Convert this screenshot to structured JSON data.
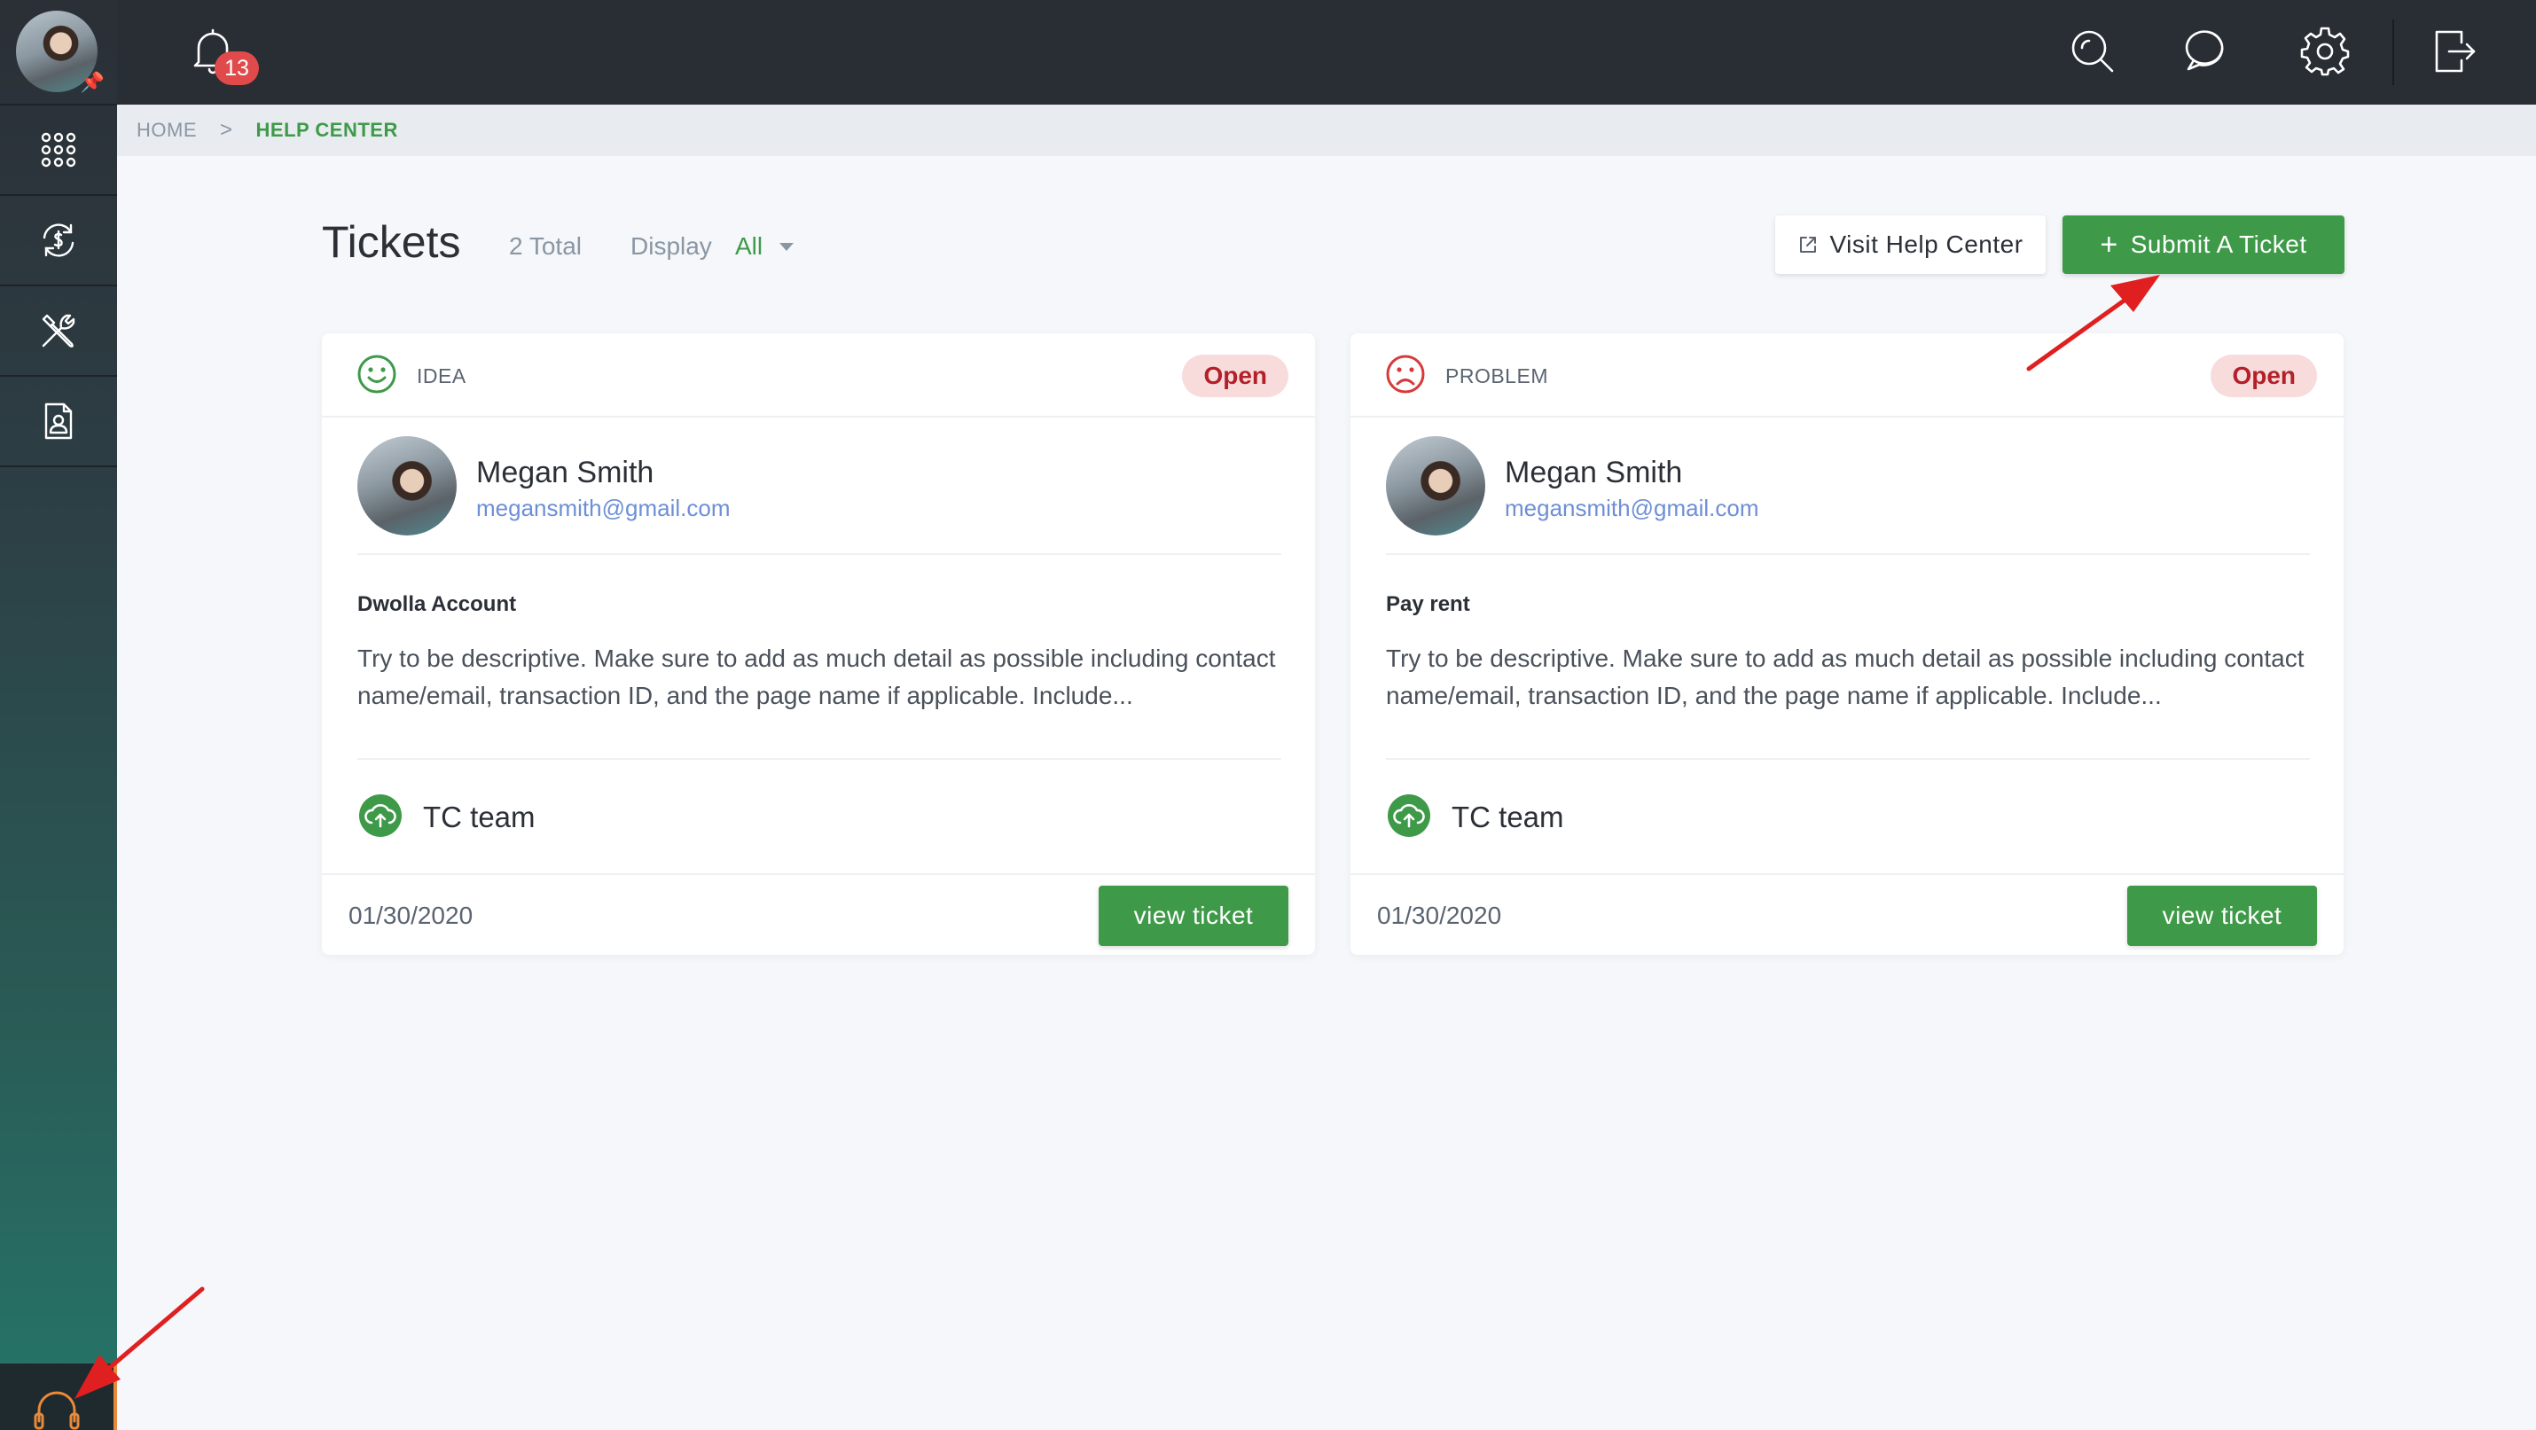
{
  "topbar": {
    "notification_count": "13"
  },
  "breadcrumb": {
    "home": "HOME",
    "separator": ">",
    "current": "HELP CENTER"
  },
  "header": {
    "title": "Tickets",
    "total": "2 Total",
    "display_label": "Display",
    "display_value": "All",
    "visit_button": "Visit Help Center",
    "submit_button": "Submit A Ticket"
  },
  "tickets": [
    {
      "type": "IDEA",
      "type_icon": "smile-face-icon",
      "status": "Open",
      "user_name": "Megan Smith",
      "user_email": "megansmith@gmail.com",
      "subject": "Dwolla Account",
      "description": "Try to be descriptive. Make sure to add as much detail as possible including contact name/email, transaction ID, and the page name if applicable. Include...",
      "team": "TC team",
      "date": "01/30/2020",
      "view_button": "view ticket"
    },
    {
      "type": "PROBLEM",
      "type_icon": "sad-face-icon",
      "status": "Open",
      "user_name": "Megan Smith",
      "user_email": "megansmith@gmail.com",
      "subject": "Pay rent",
      "description": "Try to be descriptive. Make sure to add as much detail as possible including contact name/email, transaction ID, and the page name if applicable. Include...",
      "team": "TC team",
      "date": "01/30/2020",
      "view_button": "view ticket"
    }
  ],
  "colors": {
    "accent_green": "#3e9a48",
    "badge_red": "#e04a4a",
    "status_bg": "#f8dcdc",
    "status_text": "#b3202a",
    "email_blue": "#6d8fd6",
    "annotation_red": "#e02020"
  }
}
